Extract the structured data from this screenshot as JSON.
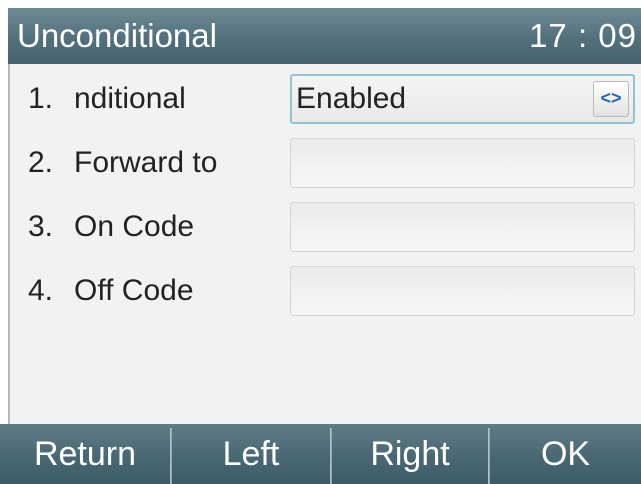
{
  "title_bar": {
    "title": "Unconditional",
    "time": "17 : 09"
  },
  "rows": [
    {
      "number": "1.",
      "label": "nditional",
      "value": "Enabled",
      "selected": true,
      "arrow_icon": "left-right-arrows-icon",
      "arrow_glyph": "<>"
    },
    {
      "number": "2.",
      "label": "Forward to",
      "value": ""
    },
    {
      "number": "3.",
      "label": "On Code",
      "value": ""
    },
    {
      "number": "4.",
      "label": "Off Code",
      "value": ""
    }
  ],
  "softkeys": {
    "return": "Return",
    "left": "Left",
    "right": "Right",
    "ok": "OK"
  },
  "colors": {
    "title_bar": "#52707c",
    "content_bg": "#f2f2f2",
    "selected_border": "#8fc4d6",
    "arrow_glyph": "#2a66b5",
    "softkey_bar": "#4a6874"
  }
}
